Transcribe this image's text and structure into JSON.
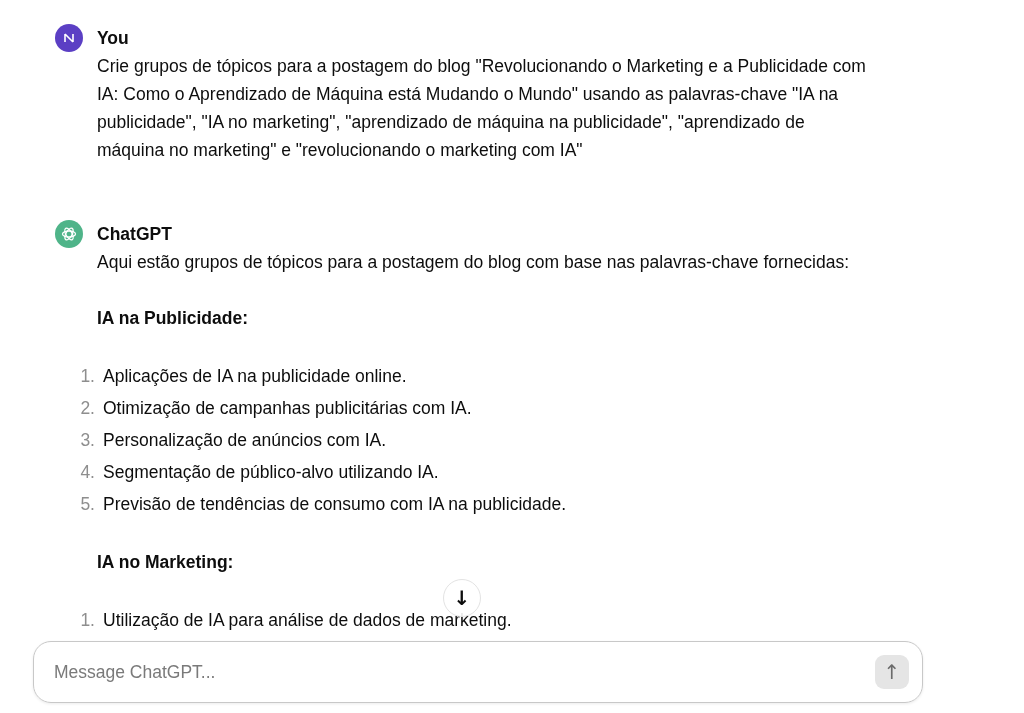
{
  "messages": [
    {
      "kind": "user",
      "author": "You",
      "paragraphs": [
        "Crie grupos de tópicos para a postagem do blog \"Revolucionando o Marketing e a Publicidade com IA: Como o Aprendizado de Máquina está Mudando o Mundo\" usando as palavras-chave \"IA na publicidade\", \"IA no marketing\", \"aprendizado de máquina na publicidade\", \"aprendizado de máquina no marketing\" e \"revolucionando o marketing com IA\""
      ]
    },
    {
      "kind": "assistant",
      "author": "ChatGPT",
      "paragraphs": [
        "Aqui estão grupos de tópicos para a postagem do blog com base nas palavras-chave fornecidas:"
      ],
      "sections": [
        {
          "heading": "IA na Publicidade:",
          "items": [
            {
              "number": "1.",
              "text": "Aplicações de IA na publicidade online."
            },
            {
              "number": "2.",
              "text": "Otimização de campanhas publicitárias com IA."
            },
            {
              "number": "3.",
              "text": "Personalização de anúncios com IA."
            },
            {
              "number": "4.",
              "text": "Segmentação de público-alvo utilizando IA."
            },
            {
              "number": "5.",
              "text": "Previsão de tendências de consumo com IA na publicidade."
            }
          ]
        },
        {
          "heading": "IA no Marketing:",
          "items": [
            {
              "number": "1.",
              "text": "Utilização de IA para análise de dados de marketing."
            }
          ]
        }
      ]
    }
  ],
  "scroll_down_button": {
    "label": "↓"
  },
  "composer": {
    "placeholder": "Message ChatGPT...",
    "send_button": {
      "label": "↑",
      "disabled": true
    }
  }
}
